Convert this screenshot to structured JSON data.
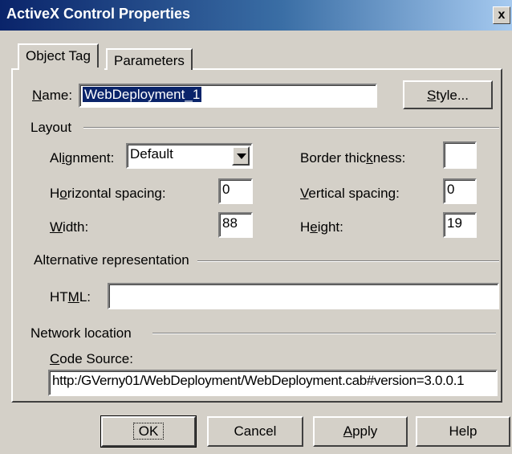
{
  "window": {
    "title": "ActiveX Control Properties",
    "close_label": "x"
  },
  "tabs": [
    {
      "label": "Object Tag",
      "active": true
    },
    {
      "label": "Parameters",
      "active": false
    }
  ],
  "name": {
    "label_accel": "N",
    "label_rest": "ame:",
    "value": "WebDeployment_1"
  },
  "style_button": {
    "accel": "S",
    "rest": "tyle..."
  },
  "layout": {
    "group_label": "Layout",
    "alignment": {
      "pre": "Al",
      "accel": "i",
      "post": "gnment:",
      "value": "Default"
    },
    "border_thickness": {
      "pre": "Border thic",
      "accel": "k",
      "post": "ness:",
      "value": ""
    },
    "horizontal_spacing": {
      "pre": "H",
      "accel": "o",
      "post": "rizontal spacing:",
      "value": "0"
    },
    "vertical_spacing": {
      "pre": "",
      "accel": "V",
      "post": "ertical spacing:",
      "value": "0"
    },
    "width": {
      "pre": "",
      "accel": "W",
      "post": "idth:",
      "value": "88"
    },
    "height": {
      "pre": "H",
      "accel": "e",
      "post": "ight:",
      "value": "19"
    }
  },
  "alternative": {
    "group_label": "Alternative representation",
    "html": {
      "pre": "HT",
      "accel": "M",
      "post": "L:",
      "value": ""
    }
  },
  "network": {
    "group_label": "Network location",
    "code_source": {
      "pre": "",
      "accel": "C",
      "post": "ode Source:",
      "value": "http:/GVerny01/WebDeployment/WebDeployment.cab#version=3.0.0.1"
    }
  },
  "buttons": {
    "ok": "OK",
    "cancel": "Cancel",
    "apply": {
      "accel": "A",
      "rest": "pply"
    },
    "help": "Help"
  },
  "colors": {
    "title_bar": "#0a246a",
    "face": "#d4d0c8",
    "selection": "#0a246a"
  }
}
